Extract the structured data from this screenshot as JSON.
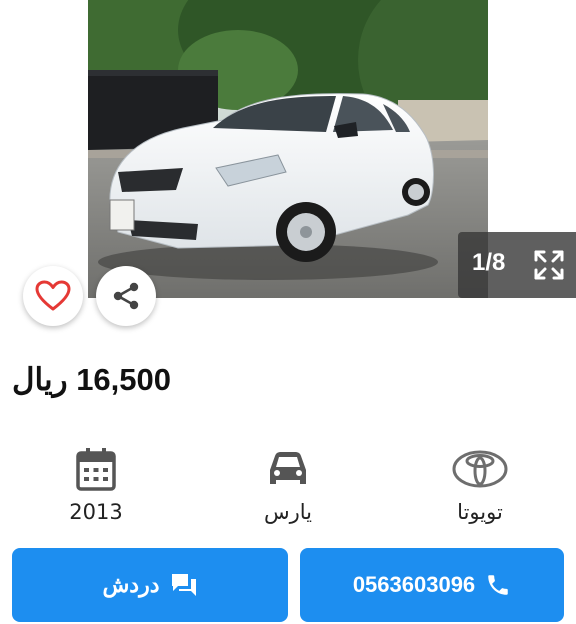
{
  "gallery": {
    "counter": "1/8",
    "current_index": 1,
    "total_images": 8
  },
  "listing": {
    "price": "16,500 ريال"
  },
  "specs": {
    "year": {
      "value": "2013",
      "icon": "calendar-icon"
    },
    "body_type": {
      "value": "يارس",
      "icon": "car-icon"
    },
    "make": {
      "value": "تويوتا",
      "icon": "toyota-logo"
    }
  },
  "actions": {
    "chat_label": "دردش",
    "call_label": "0563603096"
  },
  "colors": {
    "accent": "#1d8ef0",
    "favorite": "#e53935",
    "icon_gray": "#555555"
  }
}
